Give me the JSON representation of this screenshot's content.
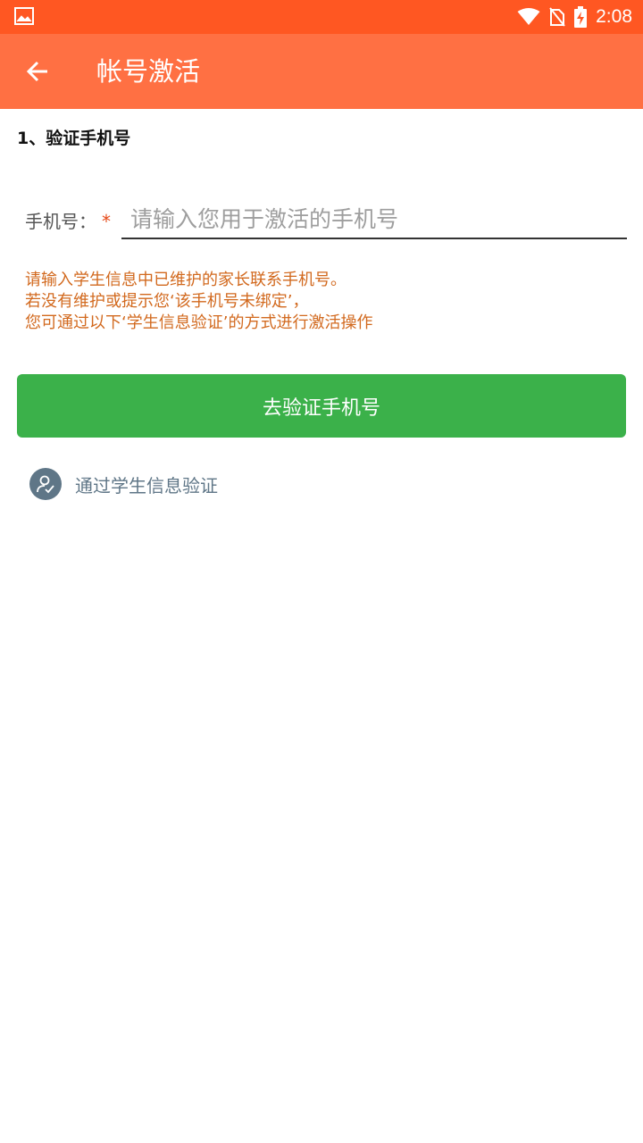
{
  "status_bar": {
    "time": "2:08",
    "icons": [
      "image-icon",
      "wifi-icon",
      "no-sim-icon",
      "battery-charging-icon"
    ]
  },
  "app_bar": {
    "title": "帐号激活",
    "back_icon": "arrow-left-icon"
  },
  "section": {
    "title": "1、验证手机号"
  },
  "phone_field": {
    "label": "手机号：",
    "required_mark": "*",
    "placeholder": "请输入您用于激活的手机号",
    "value": ""
  },
  "hint": {
    "lines": [
      "请输入学生信息中已维护的家长联系手机号。",
      "若没有维护或提示您‘该手机号未绑定’，",
      "您可通过以下‘学生信息验证’的方式进行激活操作"
    ]
  },
  "verify_button": {
    "label": "去验证手机号"
  },
  "student_verify": {
    "label": "通过学生信息验证",
    "icon": "user-check-icon"
  },
  "colors": {
    "status_bar": "#ff5722",
    "app_bar": "#ff7043",
    "button": "#3bb14a",
    "hint_text": "#d2691e",
    "link_text": "#5f7687"
  }
}
